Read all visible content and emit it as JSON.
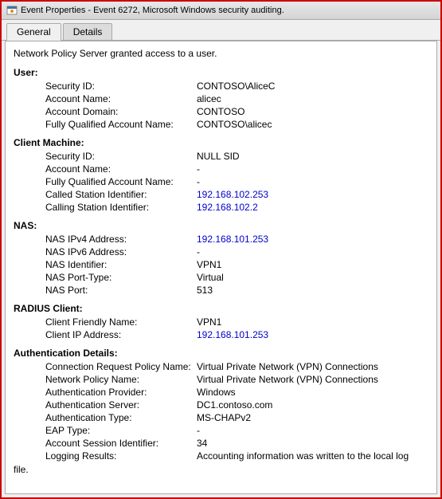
{
  "window": {
    "title": "Event Properties - Event 6272, Microsoft Windows security auditing.",
    "icon": "event-icon"
  },
  "tabs": [
    {
      "id": "general",
      "label": "General",
      "active": true
    },
    {
      "id": "details",
      "label": "Details",
      "active": false
    }
  ],
  "content": {
    "description": "Network Policy Server granted access to a user.",
    "sections": [
      {
        "id": "user",
        "label": "User:",
        "fields": [
          {
            "name": "Security ID:",
            "value": "CONTOSO\\AliceC",
            "blue": false
          },
          {
            "name": "Account Name:",
            "value": "alicec",
            "blue": false
          },
          {
            "name": "Account Domain:",
            "value": "CONTOSO",
            "blue": false
          },
          {
            "name": "Fully Qualified Account Name:",
            "value": "CONTOSO\\alicec",
            "blue": false
          }
        ]
      },
      {
        "id": "client-machine",
        "label": "Client Machine:",
        "fields": [
          {
            "name": "Security ID:",
            "value": "NULL SID",
            "blue": false
          },
          {
            "name": "Account Name:",
            "value": "-",
            "blue": false
          },
          {
            "name": "Fully Qualified Account Name:",
            "value": "-",
            "blue": false
          },
          {
            "name": "Called Station Identifier:",
            "value": "192.168.102.253",
            "blue": true
          },
          {
            "name": "Calling Station Identifier:",
            "value": "192.168.102.2",
            "blue": true
          }
        ]
      },
      {
        "id": "nas",
        "label": "NAS:",
        "fields": [
          {
            "name": "NAS IPv4 Address:",
            "value": "192.168.101.253",
            "blue": true
          },
          {
            "name": "NAS IPv6 Address:",
            "value": "-",
            "blue": false
          },
          {
            "name": "NAS Identifier:",
            "value": "VPN1",
            "blue": false
          },
          {
            "name": "NAS Port-Type:",
            "value": "Virtual",
            "blue": false
          },
          {
            "name": "NAS Port:",
            "value": "513",
            "blue": false
          }
        ]
      },
      {
        "id": "radius-client",
        "label": "RADIUS Client:",
        "fields": [
          {
            "name": "Client Friendly Name:",
            "value": "VPN1",
            "blue": false
          },
          {
            "name": "Client IP Address:",
            "value": "192.168.101.253",
            "blue": true
          }
        ]
      },
      {
        "id": "authentication-details",
        "label": "Authentication Details:",
        "fields": [
          {
            "name": "Connection Request Policy Name:",
            "value": "Virtual Private Network (VPN) Connections",
            "blue": false
          },
          {
            "name": "Network Policy Name:",
            "value": "Virtual Private Network (VPN) Connections",
            "blue": false
          },
          {
            "name": "Authentication Provider:",
            "value": "Windows",
            "blue": false
          },
          {
            "name": "Authentication Server:",
            "value": "DC1.contoso.com",
            "blue": false
          },
          {
            "name": "Authentication Type:",
            "value": "MS-CHAPv2",
            "blue": false
          },
          {
            "name": "EAP Type:",
            "value": "-",
            "blue": false
          },
          {
            "name": "Account Session Identifier:",
            "value": "34",
            "blue": false
          },
          {
            "name": "Logging Results:",
            "value": "Accounting information was written to the local log",
            "blue": false
          }
        ]
      }
    ],
    "bottom_note": "file."
  }
}
